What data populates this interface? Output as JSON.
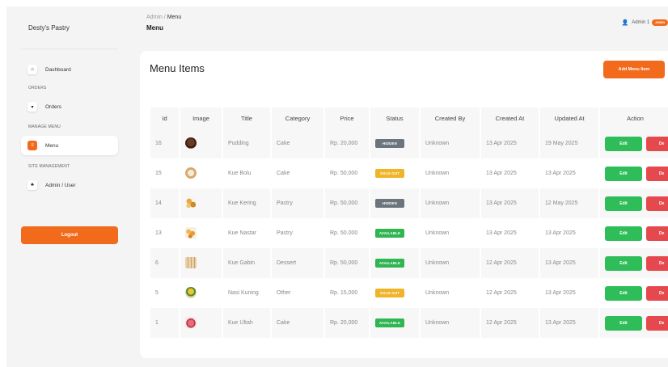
{
  "brand": "Desty's Pastry",
  "breadcrumb": {
    "root": "Admin",
    "separator": "/",
    "current": "Menu"
  },
  "page_title": "Menu",
  "user": {
    "name": "Admin 1",
    "role": "ADMIN"
  },
  "sidebar": {
    "items": [
      {
        "label": "Dashboard",
        "icon": "home-icon"
      },
      {
        "section": "ORDERS"
      },
      {
        "label": "Orders",
        "icon": "cart-icon"
      },
      {
        "section": "MANAGE MENU"
      },
      {
        "label": "Menu",
        "icon": "menu-icon",
        "active": true
      },
      {
        "section": "SITE MANAGEMENT"
      },
      {
        "label": "Admin / User",
        "icon": "users-icon"
      }
    ],
    "logout_label": "Logout"
  },
  "card": {
    "title": "Menu Items",
    "add_button_label": "Add Menu Item"
  },
  "table": {
    "columns": [
      "Id",
      "Image",
      "Title",
      "Category",
      "Price",
      "Status",
      "Created By",
      "Created At",
      "Updated At",
      "Action"
    ],
    "rows": [
      {
        "id": "16",
        "image": "pudding-photo",
        "title": "Pudding",
        "category": "Cake",
        "price": "Rp. 20,000",
        "status": "HIDDEN",
        "created_by": "Unknown",
        "created_at": "13 Apr 2025",
        "updated_at": "19 May 2025"
      },
      {
        "id": "15",
        "image": "kue-bolu-photo",
        "title": "Kue Bolu",
        "category": "Cake",
        "price": "Rp. 50,000",
        "status": "SOLD OUT",
        "created_by": "Unknown",
        "created_at": "13 Apr 2025",
        "updated_at": "13 Apr 2025"
      },
      {
        "id": "14",
        "image": "kue-kering-photo",
        "title": "Kue Kering",
        "category": "Pastry",
        "price": "Rp. 50,000",
        "status": "HIDDEN",
        "created_by": "Unknown",
        "created_at": "13 Apr 2025",
        "updated_at": "12 May 2025"
      },
      {
        "id": "13",
        "image": "kue-nastar-photo",
        "title": "Kue Nastar",
        "category": "Pastry",
        "price": "Rp. 50,000",
        "status": "AVAILABLE",
        "created_by": "Unknown",
        "created_at": "13 Apr 2025",
        "updated_at": "13 Apr 2025"
      },
      {
        "id": "6",
        "image": "kue-gabin-photo",
        "title": "Kue Gabin",
        "category": "Dessert",
        "price": "Rp. 50,000",
        "status": "AVAILABLE",
        "created_by": "Unknown",
        "created_at": "12 Apr 2025",
        "updated_at": "13 Apr 2025"
      },
      {
        "id": "5",
        "image": "nasi-kuning-photo",
        "title": "Nasi Kuning",
        "category": "Other",
        "price": "Rp. 15,000",
        "status": "SOLD OUT",
        "created_by": "Unknown",
        "created_at": "12 Apr 2025",
        "updated_at": "13 Apr 2025"
      },
      {
        "id": "1",
        "image": "kue-ultah-photo",
        "title": "Kue Ultah",
        "category": "Cake",
        "price": "Rp. 20,000",
        "status": "AVAILABLE",
        "created_by": "Unknown",
        "created_at": "12 Apr 2025",
        "updated_at": "13 Apr 2025"
      }
    ],
    "actions": {
      "edit_label": "Edit",
      "delete_label": "De"
    }
  },
  "colors": {
    "accent": "#f26a1b",
    "hidden": "#6c757d",
    "sold_out": "#f0b429",
    "available": "#2fb551",
    "edit": "#2ebd59",
    "delete": "#e5484d"
  }
}
